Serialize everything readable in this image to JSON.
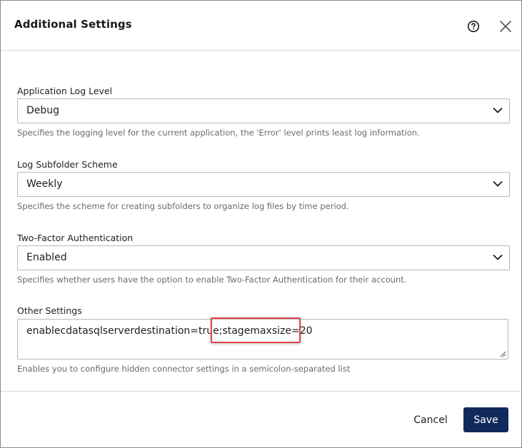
{
  "dialog": {
    "title": "Additional Settings",
    "icons": {
      "help": "help-circle-icon",
      "close": "close-icon"
    }
  },
  "fields": {
    "log_level": {
      "label": "Application Log Level",
      "value": "Debug",
      "help": "Specifies the logging level for the current application, the 'Error' level prints least log information."
    },
    "log_subfolder": {
      "label": "Log Subfolder Scheme",
      "value": "Weekly",
      "help": "Specifies the scheme for creating subfolders to organize log files by time period."
    },
    "two_factor": {
      "label": "Two-Factor Authentication",
      "value": "Enabled",
      "help": "Specifies whether users have the option to enable Two-Factor Authentication for their account."
    },
    "other_settings": {
      "label": "Other Settings",
      "value": "enablecdatasqlserverdestination=true;stagemaxsize=20",
      "help": "Enables you to configure hidden connector settings in a semicolon-separated list"
    }
  },
  "footer": {
    "cancel_label": "Cancel",
    "save_label": "Save"
  },
  "colors": {
    "primary_button": "#112a5c",
    "highlight": "#e04444",
    "help_text": "#6b6b6b"
  }
}
